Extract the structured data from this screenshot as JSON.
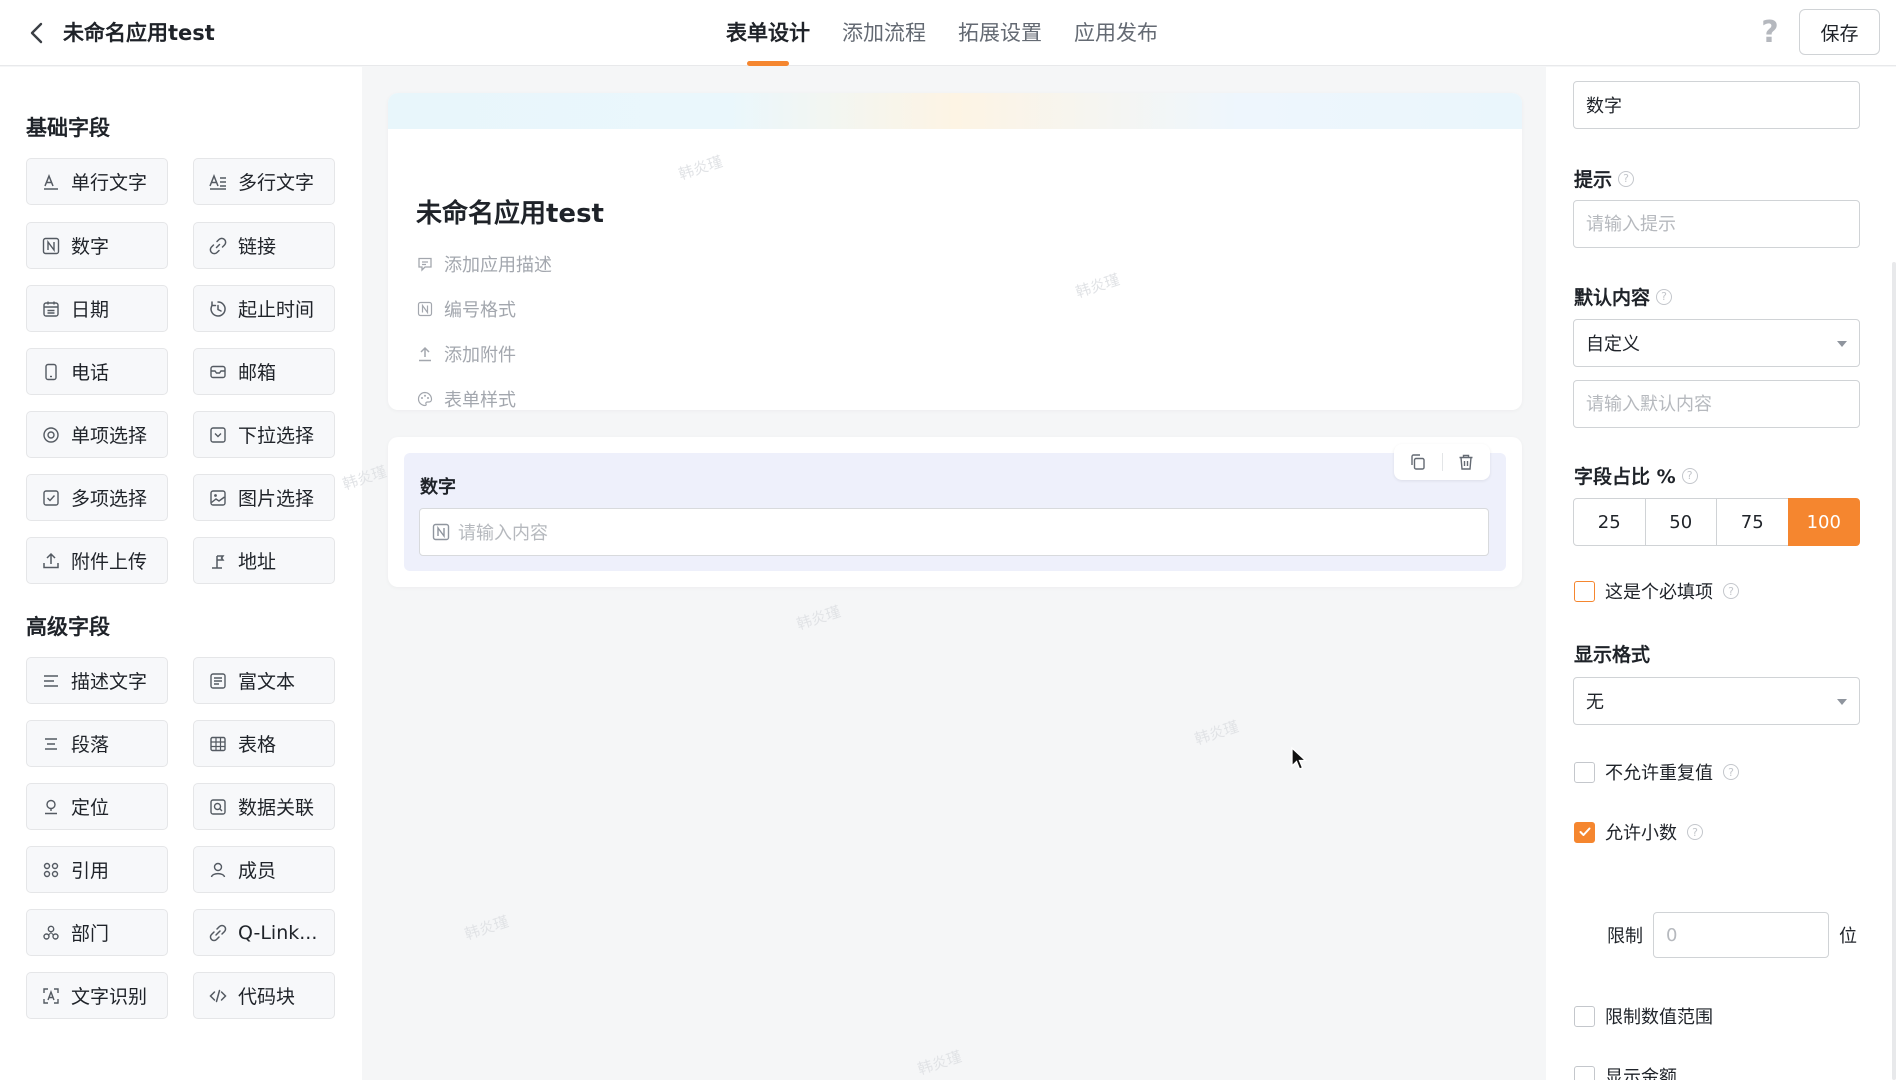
{
  "header": {
    "app_title": "未命名应用test",
    "tabs": [
      {
        "label": "表单设计",
        "active": true
      },
      {
        "label": "添加流程",
        "active": false
      },
      {
        "label": "拓展设置",
        "active": false
      },
      {
        "label": "应用发布",
        "active": false
      }
    ],
    "help_icon": "?",
    "save_label": "保存"
  },
  "palette": {
    "basic_title": "基础字段",
    "basic_fields": [
      {
        "label": "单行文字",
        "icon": "single-line-text-icon"
      },
      {
        "label": "多行文字",
        "icon": "multi-line-text-icon"
      },
      {
        "label": "数字",
        "icon": "number-icon"
      },
      {
        "label": "链接",
        "icon": "link-icon"
      },
      {
        "label": "日期",
        "icon": "calendar-icon"
      },
      {
        "label": "起止时间",
        "icon": "clock-icon"
      },
      {
        "label": "电话",
        "icon": "phone-icon"
      },
      {
        "label": "邮箱",
        "icon": "mail-icon"
      },
      {
        "label": "单项选择",
        "icon": "radio-icon"
      },
      {
        "label": "下拉选择",
        "icon": "dropdown-icon"
      },
      {
        "label": "多项选择",
        "icon": "checkbox-icon"
      },
      {
        "label": "图片选择",
        "icon": "image-icon"
      },
      {
        "label": "附件上传",
        "icon": "upload-icon"
      },
      {
        "label": "地址",
        "icon": "location-pin-icon"
      }
    ],
    "advanced_title": "高级字段",
    "advanced_fields": [
      {
        "label": "描述文字",
        "icon": "description-icon"
      },
      {
        "label": "富文本",
        "icon": "rich-text-icon"
      },
      {
        "label": "段落",
        "icon": "paragraph-icon"
      },
      {
        "label": "表格",
        "icon": "table-icon"
      },
      {
        "label": "定位",
        "icon": "map-pin-icon"
      },
      {
        "label": "数据关联",
        "icon": "data-link-icon"
      },
      {
        "label": "引用",
        "icon": "reference-icon"
      },
      {
        "label": "成员",
        "icon": "person-icon"
      },
      {
        "label": "部门",
        "icon": "department-icon"
      },
      {
        "label": "Q-Link...",
        "icon": "qlink-icon"
      },
      {
        "label": "文字识别",
        "icon": "ocr-scan-icon"
      },
      {
        "label": "代码块",
        "icon": "code-icon"
      }
    ]
  },
  "canvas": {
    "form_title": "未命名应用test",
    "meta_items": [
      {
        "label": "添加应用描述",
        "icon": "comment-icon"
      },
      {
        "label": "编号格式",
        "icon": "number-format-icon"
      },
      {
        "label": "添加附件",
        "icon": "upload-icon"
      },
      {
        "label": "表单样式",
        "icon": "palette-icon"
      }
    ],
    "field_label": "数字",
    "field_placeholder": "请输入内容",
    "watermark": "韩炎瑾"
  },
  "props": {
    "title_value": "数字",
    "hint_label": "提示",
    "hint_placeholder": "请输入提示",
    "default_label": "默认内容",
    "default_select": "自定义",
    "default_placeholder": "请输入默认内容",
    "width_label": "字段占比 %",
    "width_options": [
      "25",
      "50",
      "75",
      "100"
    ],
    "width_selected": "100",
    "required_label": "这是个必填项",
    "display_format_label": "显示格式",
    "display_format_value": "无",
    "no_duplicate_label": "不允许重复值",
    "allow_decimal_label": "允许小数",
    "allow_decimal_checked": true,
    "limit_label": "限制",
    "limit_placeholder": "0",
    "limit_unit": "位",
    "range_label": "限制数值范围",
    "amount_label": "显示金额"
  },
  "colors": {
    "accent": "#f5862f",
    "selected_field_bg": "#eef0fb"
  }
}
